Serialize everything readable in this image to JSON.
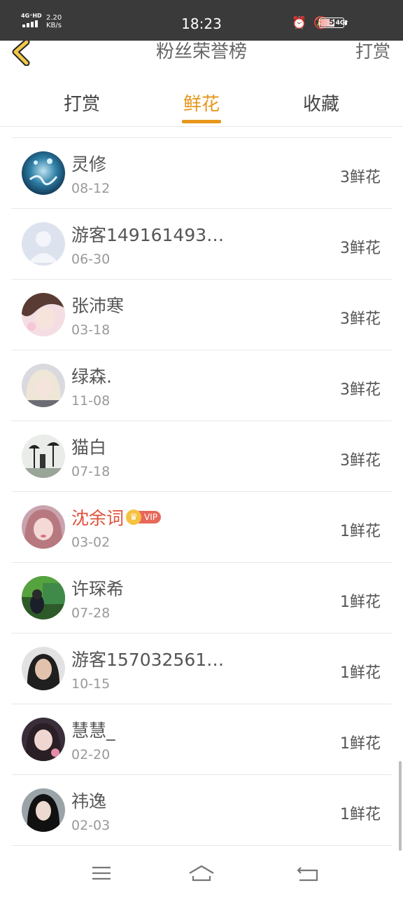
{
  "status_bar": {
    "network_label": "4G⁺HD",
    "speed_value": "2.20",
    "speed_unit": "KB/s",
    "time": "18:23",
    "net_type": "4G⁺",
    "battery": "5"
  },
  "header": {
    "title": "粉丝荣誉榜",
    "right_action": "打赏"
  },
  "tabs": [
    {
      "label": "打赏",
      "active": false
    },
    {
      "label": "鲜花",
      "active": true
    },
    {
      "label": "收藏",
      "active": false
    }
  ],
  "fans": [
    {
      "name": "灵修",
      "date": "08-12",
      "amount": "3鲜花",
      "avatar": "avatar-1-icon"
    },
    {
      "name": "游客149161493…",
      "date": "06-30",
      "amount": "3鲜花",
      "avatar": "default-avatar-icon"
    },
    {
      "name": "张沛寒",
      "date": "03-18",
      "amount": "3鲜花",
      "avatar": "avatar-3-icon"
    },
    {
      "name": "绿森.",
      "date": "11-08",
      "amount": "3鲜花",
      "avatar": "avatar-4-icon"
    },
    {
      "name": "猫白",
      "date": "07-18",
      "amount": "3鲜花",
      "avatar": "avatar-5-icon"
    },
    {
      "name": "沈余词",
      "date": "03-02",
      "amount": "1鲜花",
      "avatar": "avatar-6-icon",
      "vip": true,
      "vip_label": "VIP"
    },
    {
      "name": "许琛希",
      "date": "07-28",
      "amount": "1鲜花",
      "avatar": "avatar-7-icon"
    },
    {
      "name": "游客157032561…",
      "date": "10-15",
      "amount": "1鲜花",
      "avatar": "avatar-8-icon"
    },
    {
      "name": "慧慧_",
      "date": "02-20",
      "amount": "1鲜花",
      "avatar": "avatar-9-icon"
    },
    {
      "name": "祎逸",
      "date": "02-03",
      "amount": "1鲜花",
      "avatar": "avatar-10-icon"
    }
  ],
  "colors": {
    "accent": "#e8961b",
    "vip_name": "#e0503a",
    "status_bar": "#3a3a3a"
  }
}
